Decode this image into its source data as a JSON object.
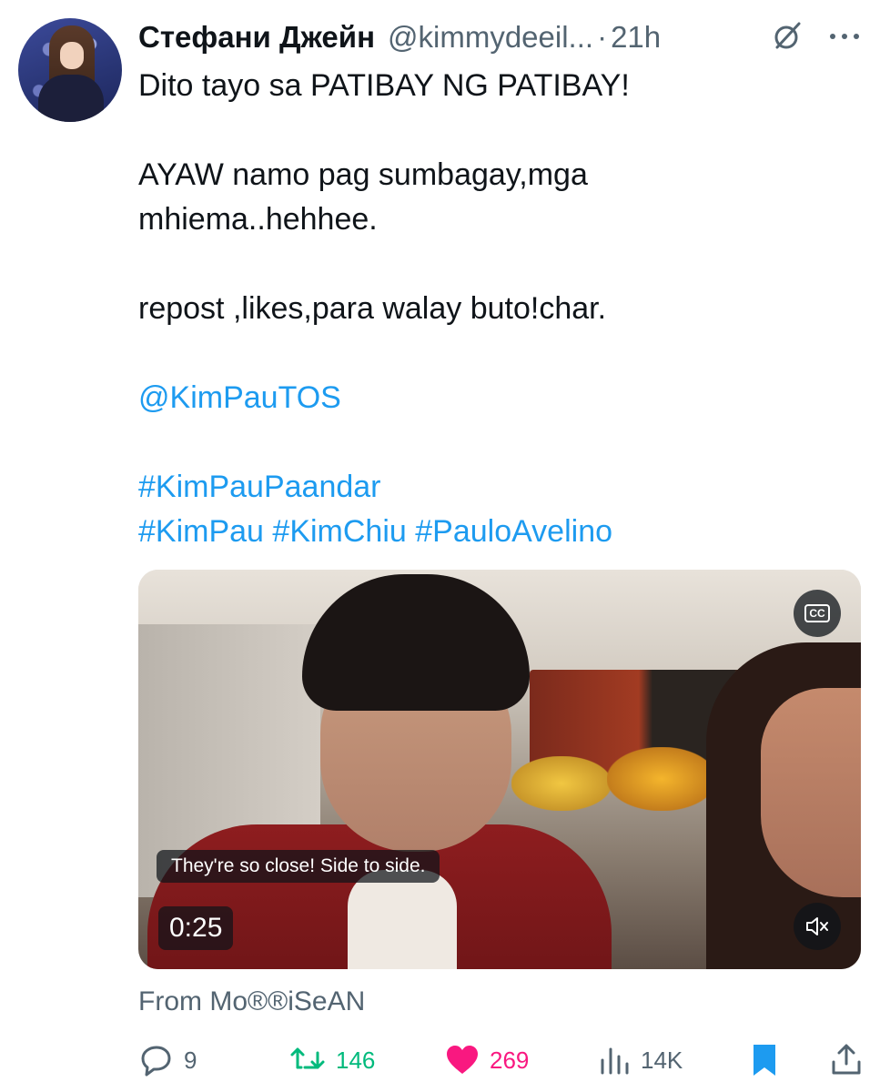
{
  "author": {
    "name": "Стефани Джейн",
    "handle": "@kimmydeeil...",
    "separator": "·",
    "time": "21h"
  },
  "tweet": {
    "lines": [
      "Dito tayo sa PATIBAY NG PATIBAY!",
      "AYAW namo pag sumbagay,mga",
      "mhiema..hehhee.",
      "repost ,likes,para walay buto!char.",
      "@KimPauTOS",
      "#KimPauPaandar",
      "#KimPau #KimChiu #PauloAvelino"
    ]
  },
  "media": {
    "cc_label": "CC",
    "caption": "They're so close! Side to side.",
    "timer": "0:25"
  },
  "attribution": "From Mo®®iSeAN",
  "actions": {
    "replies": "9",
    "reposts": "146",
    "likes": "269",
    "views": "14K"
  },
  "colors": {
    "link": "#1d9bf0",
    "repost": "#00ba7c",
    "like": "#f91880",
    "muted": "#536471",
    "bookmark": "#1d9bf0"
  },
  "icons": [
    "grok-icon",
    "more-icon",
    "cc-icon",
    "mute-icon",
    "reply-icon",
    "repost-icon",
    "like-icon",
    "views-icon",
    "bookmark-icon",
    "share-icon"
  ]
}
